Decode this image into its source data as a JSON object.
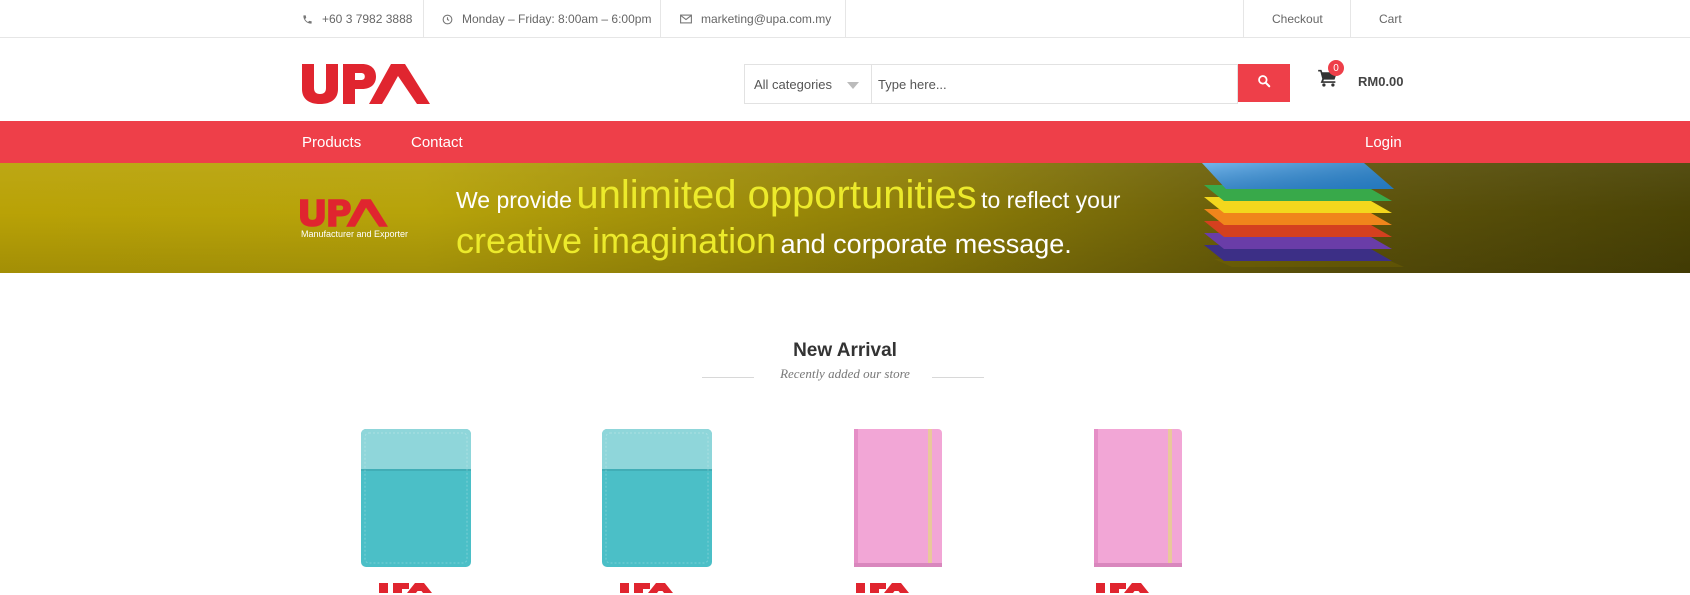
{
  "topbar": {
    "phone": "+60 3 7982 3888",
    "hours": "Monday – Friday: 8:00am – 6:00pm",
    "email": "marketing@upa.com.my",
    "checkout": "Checkout",
    "cart": "Cart"
  },
  "header": {
    "logo_text": "UPA",
    "category_select": "All categories",
    "search_placeholder": "Type here...",
    "cart_count": "0",
    "cart_total": "RM0.00"
  },
  "nav": {
    "products": "Products",
    "contact": "Contact",
    "login": "Login"
  },
  "banner": {
    "logo_text": "UPA",
    "tagline_sub": "Manufacturer and Exporter",
    "line1_a": "We provide",
    "line1_b": "unlimited opportunities",
    "line1_c": "to reflect your",
    "line2_a": "creative imagination",
    "line2_b": "and corporate message."
  },
  "new_arrival": {
    "title": "New Arrival",
    "subtitle": "Recently added our store",
    "products": [
      {
        "color": "teal"
      },
      {
        "color": "teal"
      },
      {
        "color": "pink"
      },
      {
        "color": "pink"
      }
    ]
  },
  "colors": {
    "brand_red": "#ee3f49",
    "banner_yellow": "#ecea2b"
  }
}
